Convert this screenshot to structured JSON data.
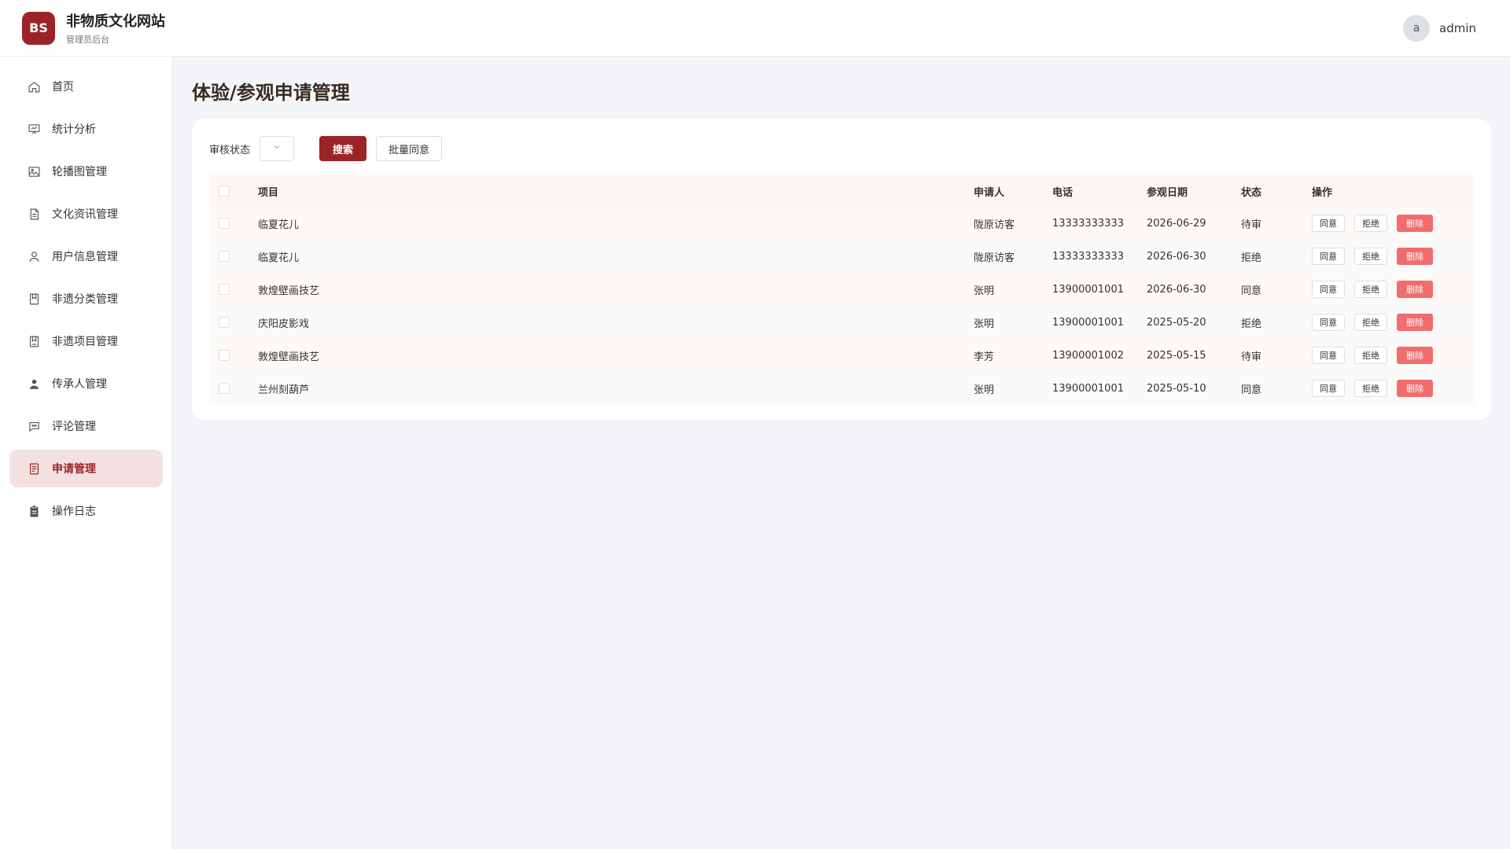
{
  "header": {
    "logo": "BS",
    "title": "非物质文化网站",
    "subtitle": "管理员后台",
    "avatar_letter": "a",
    "username": "admin"
  },
  "sidebar": {
    "items": [
      {
        "label": "首页",
        "icon": "home-icon"
      },
      {
        "label": "统计分析",
        "icon": "chart-icon"
      },
      {
        "label": "轮播图管理",
        "icon": "image-icon"
      },
      {
        "label": "文化资讯管理",
        "icon": "document-icon"
      },
      {
        "label": "用户信息管理",
        "icon": "user-icon"
      },
      {
        "label": "非遗分类管理",
        "icon": "category-icon"
      },
      {
        "label": "非遗项目管理",
        "icon": "project-icon"
      },
      {
        "label": "传承人管理",
        "icon": "inheritor-icon"
      },
      {
        "label": "评论管理",
        "icon": "comment-icon"
      },
      {
        "label": "申请管理",
        "icon": "application-icon",
        "active": true
      },
      {
        "label": "操作日志",
        "icon": "log-icon"
      }
    ]
  },
  "main": {
    "title": "体验/参观申请管理",
    "filter": {
      "label": "审核状态",
      "search_label": "搜索",
      "batch_label": "批量同意"
    },
    "table": {
      "headers": {
        "project": "项目",
        "applicant": "申请人",
        "phone": "电话",
        "date": "参观日期",
        "status": "状态",
        "ops": "操作"
      },
      "op_labels": {
        "approve": "同意",
        "reject": "拒绝",
        "delete": "删除"
      },
      "rows": [
        {
          "project": "临夏花儿",
          "applicant": "陇原访客",
          "phone": "13333333333",
          "date": "2026-06-29",
          "status": "待审"
        },
        {
          "project": "临夏花儿",
          "applicant": "陇原访客",
          "phone": "13333333333",
          "date": "2026-06-30",
          "status": "拒绝"
        },
        {
          "project": "敦煌壁画技艺",
          "applicant": "张明",
          "phone": "13900001001",
          "date": "2026-06-30",
          "status": "同意"
        },
        {
          "project": "庆阳皮影戏",
          "applicant": "张明",
          "phone": "13900001001",
          "date": "2025-05-20",
          "status": "拒绝"
        },
        {
          "project": "敦煌壁画技艺",
          "applicant": "李芳",
          "phone": "13900001002",
          "date": "2025-05-15",
          "status": "待审"
        },
        {
          "project": "兰州刻葫芦",
          "applicant": "张明",
          "phone": "13900001001",
          "date": "2025-05-10",
          "status": "同意"
        }
      ]
    }
  },
  "colors": {
    "brand": "#9c2428",
    "danger": "#f16c6c",
    "active_bg": "#f3e1e1"
  }
}
